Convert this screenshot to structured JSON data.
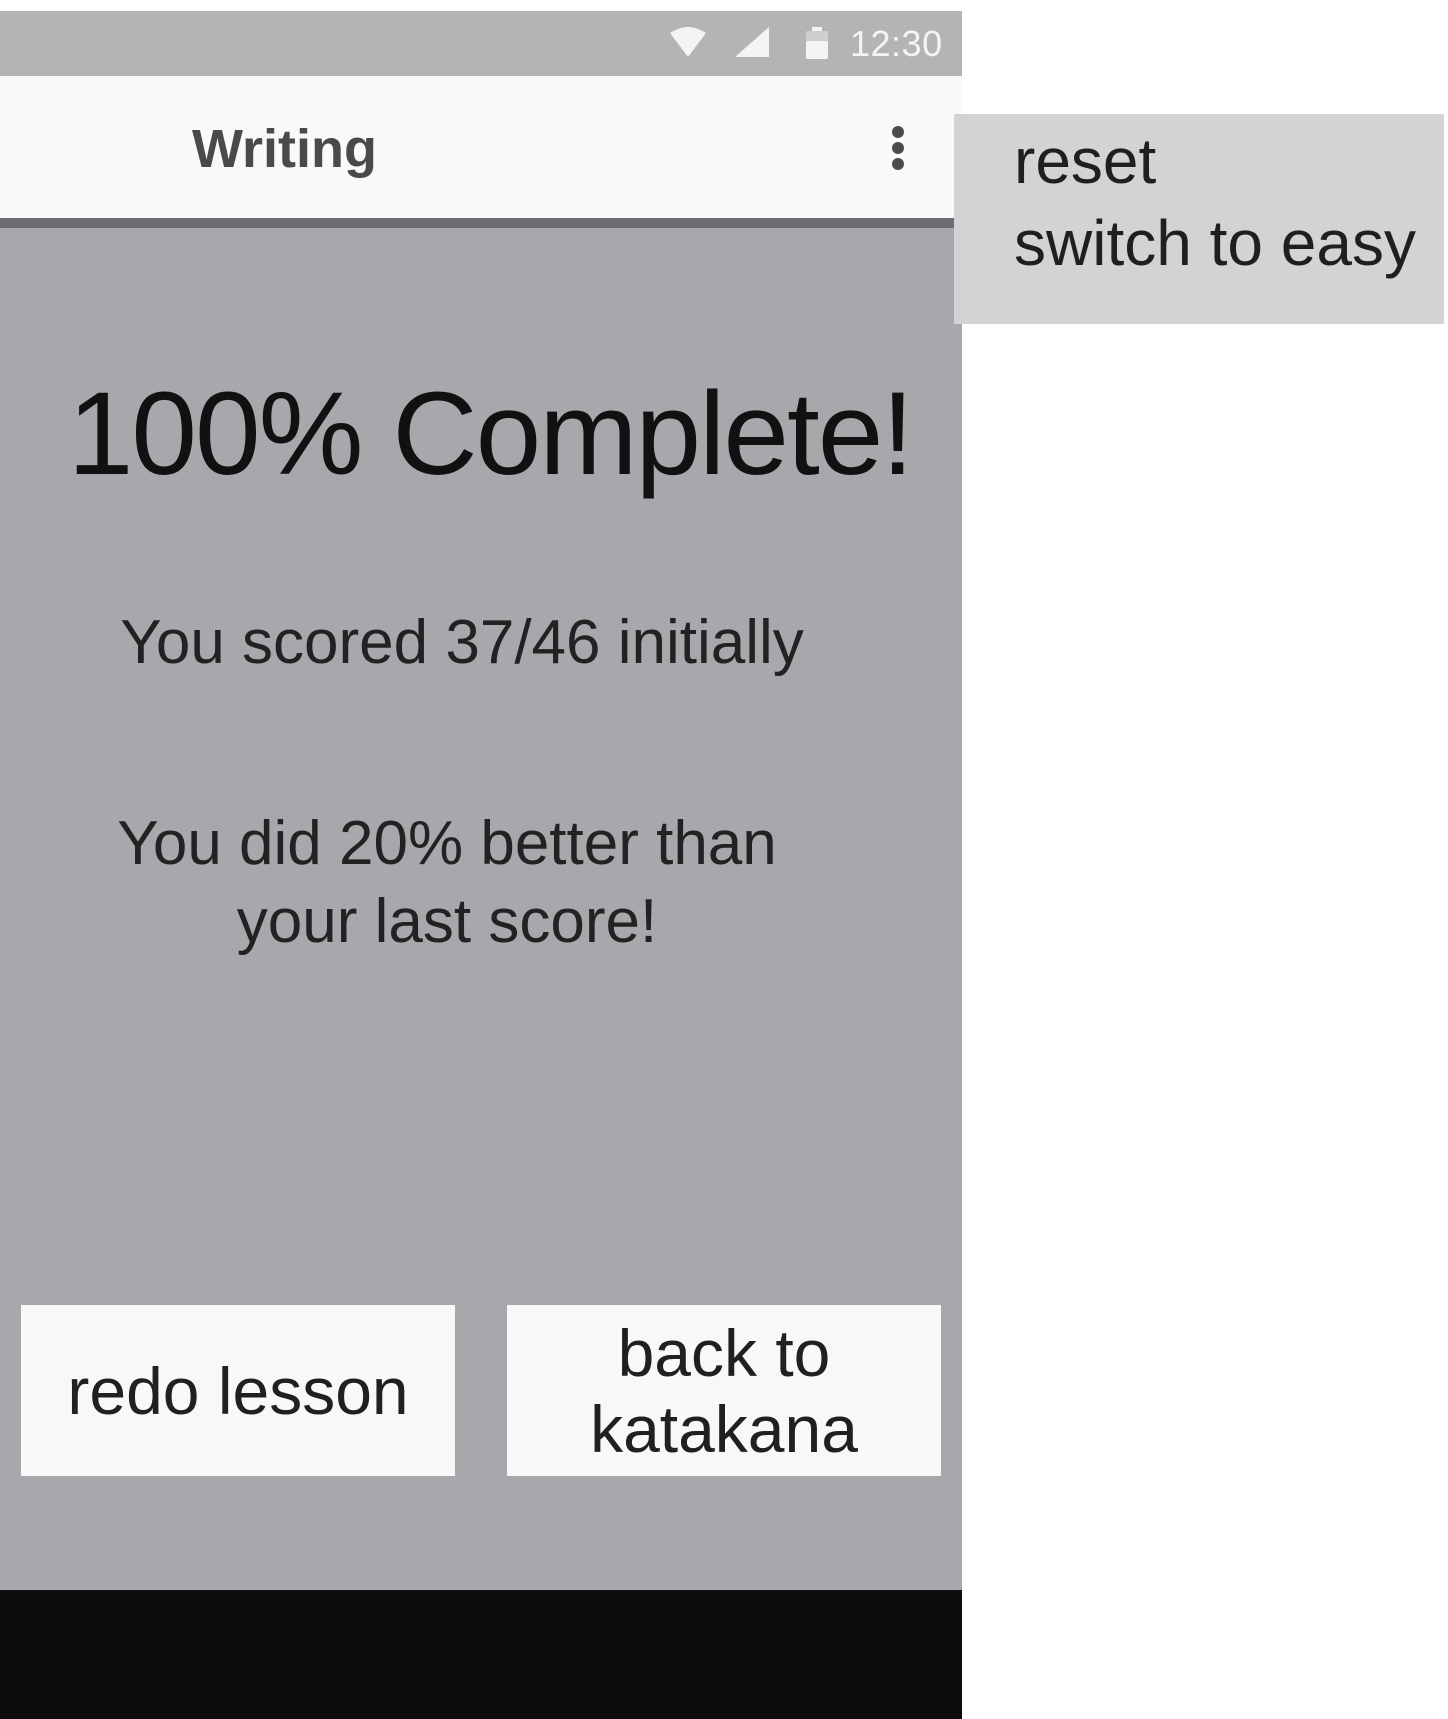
{
  "status_bar": {
    "time": "12:30",
    "icons": [
      "wifi-icon",
      "signal-icon",
      "battery-icon"
    ]
  },
  "app_bar": {
    "title": "Writing",
    "overflow_icon": "more-vert-icon"
  },
  "overflow_menu": {
    "items": [
      "reset",
      "switch to easy"
    ]
  },
  "results": {
    "title": "100% Complete!",
    "score_line": "You scored 37/46 initially",
    "improvement_line1": "You did 20% better than",
    "improvement_line2": "your last score!"
  },
  "actions": {
    "redo": "redo lesson",
    "back": "back to katakana"
  },
  "colors": {
    "screen_background": "#a7a8ac",
    "status_bar": "#b4b4b4",
    "app_bar": "#f9f9f9",
    "menu_background": "#d2d3d5",
    "nav_bar": "#0d0d0d",
    "button_background": "#f8f8f8"
  }
}
